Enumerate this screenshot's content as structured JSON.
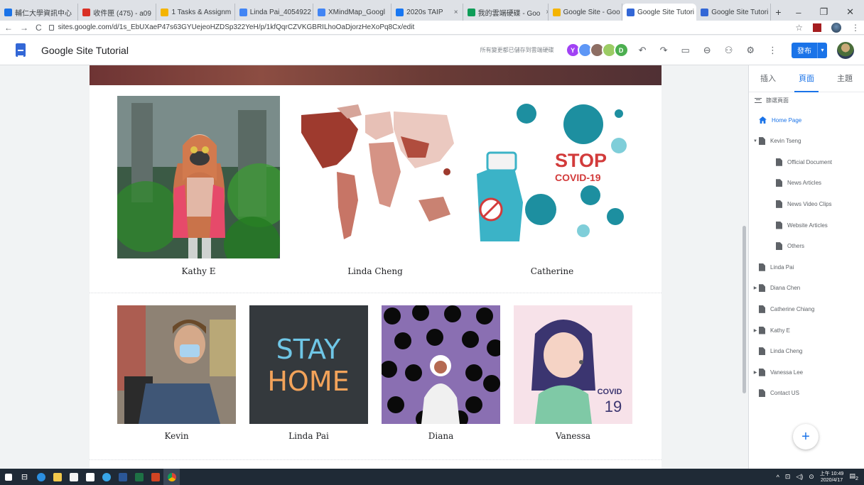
{
  "browser": {
    "tabs": [
      {
        "title": "輔仁大學資訊中心",
        "fav": "#1a73e8"
      },
      {
        "title": "收件匣 (475) - a09",
        "fav": "#d93025"
      },
      {
        "title": "1 Tasks & Assignm",
        "fav": "#f4b400"
      },
      {
        "title": "Linda Pai_4054922",
        "fav": "#4285f4"
      },
      {
        "title": "XMindMap_Googl",
        "fav": "#4285f4"
      },
      {
        "title": "2020s TAIP",
        "fav": "#1877f2"
      },
      {
        "title": "我的雲端硬碟 - Goo",
        "fav": "#0f9d58"
      },
      {
        "title": "Google Site - Goo",
        "fav": "#f4b400"
      },
      {
        "title": "Google Site Tutori",
        "fav": "#3367d6"
      },
      {
        "title": "Google Site Tutori",
        "fav": "#3367d6"
      }
    ],
    "new_tab": "+",
    "url": "sites.google.com/d/1s_EbUXaeP47s63GYUejeoHZDSp322YeH/p/1kfQqrCZVKGBRILhoOaDjorzHeXoPq8Cx/edit"
  },
  "appbar": {
    "title": "Google Site Tutorial",
    "save_status": "所有變更都已儲存到雲端硬碟",
    "avatars": [
      {
        "letter": "Y",
        "color": "#a142f4"
      },
      {
        "letter": "",
        "color": "#5e97f6"
      },
      {
        "letter": "",
        "color": "#8d6e63"
      },
      {
        "letter": "",
        "color": "#9ccc65"
      },
      {
        "letter": "D",
        "color": "#4caf50"
      }
    ],
    "publish_label": "發布"
  },
  "gallery": {
    "row1": [
      {
        "caption": "Kathy E"
      },
      {
        "caption": "Linda Cheng"
      },
      {
        "caption": "Catherine"
      }
    ],
    "row2": [
      {
        "caption": "Kevin"
      },
      {
        "caption": "Linda Pai"
      },
      {
        "caption": "Diana"
      },
      {
        "caption": "Vanessa"
      }
    ],
    "stay_home_text": [
      "STAY",
      "HOME"
    ],
    "stop_covid_text": [
      "STOP",
      "COVID-19"
    ],
    "covid19_badge": [
      "COVID",
      "19"
    ]
  },
  "panel": {
    "tabs": [
      {
        "label": "插入",
        "active": false
      },
      {
        "label": "頁面",
        "active": true
      },
      {
        "label": "主題",
        "active": false
      }
    ],
    "filter_label": "篩選頁面",
    "pages": [
      {
        "label": "Home Page",
        "indent": 0,
        "home": true,
        "arrow": ""
      },
      {
        "label": "Kevin Tseng",
        "indent": 0,
        "arrow": "▼"
      },
      {
        "label": "Official Document",
        "indent": 1,
        "arrow": ""
      },
      {
        "label": "News Articles",
        "indent": 1,
        "arrow": ""
      },
      {
        "label": "News Video Clips",
        "indent": 1,
        "arrow": ""
      },
      {
        "label": "Website Articles",
        "indent": 1,
        "arrow": ""
      },
      {
        "label": "Others",
        "indent": 1,
        "arrow": ""
      },
      {
        "label": "Linda Pai",
        "indent": 0,
        "arrow": ""
      },
      {
        "label": "Diana Chen",
        "indent": 0,
        "arrow": "▶"
      },
      {
        "label": "Catherine Chiang",
        "indent": 0,
        "arrow": ""
      },
      {
        "label": "Kathy E",
        "indent": 0,
        "arrow": "▶"
      },
      {
        "label": "Linda Cheng",
        "indent": 0,
        "arrow": ""
      },
      {
        "label": "Vanessa Lee",
        "indent": 0,
        "arrow": "▶"
      },
      {
        "label": "Contact US",
        "indent": 0,
        "arrow": ""
      }
    ],
    "fab": "+"
  },
  "taskbar": {
    "clock_time": "上午 10:49",
    "clock_date": "2020/4/17",
    "notifications": "2"
  }
}
